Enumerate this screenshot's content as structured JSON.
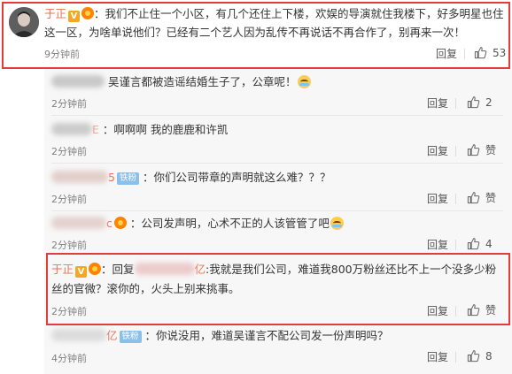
{
  "main_comment": {
    "username": "于正",
    "verified_badge": "V",
    "body": "：我们不止住一个小区，有几个还住上下楼，欢娱的导演就住我楼下，好多明星也住这一区，为啥单说他们？已经有二个艺人因为乱传不再说话不再合作了，别再来一次！",
    "time": "9分钟前",
    "reply_label": "回复",
    "like_count": "53"
  },
  "replies": [
    {
      "name": "",
      "body": "吴谨言都被造谣结婚生子了，公章呢！",
      "time": "2分钟前",
      "reply_label": "回复",
      "like_count": "2",
      "emoji": "crying-laughing"
    },
    {
      "name": "E",
      "body": "：啊啊啊  我的鹿鹿和许凯",
      "time": "2分钟前",
      "reply_label": "回复",
      "like_count": "赞"
    },
    {
      "name": "5",
      "badge": "铁粉",
      "body": "：你们公司带章的声明就这么难？？？",
      "time": "2分钟前",
      "reply_label": "回复",
      "like_count": "赞"
    },
    {
      "name": "c",
      "body": "：公司发声明，心术不正的人该管管了吧",
      "time": "2分钟前",
      "reply_label": "回复",
      "like_count": "4",
      "emoji": "crying-laughing"
    },
    {
      "name": "于正",
      "verified_badge": "V",
      "reply_prefix": "：回复",
      "reply_target": "亿",
      "body_line1": ":我就是我们公司，难道我800万粉丝还比不上一个没多少粉",
      "body_line2": "丝的官微？滚你的，火头上别来挑事。",
      "time": "2分钟前",
      "reply_label": "回复",
      "like_count": "赞"
    },
    {
      "name": "亿",
      "badge": "铁粉",
      "body": "：你说没用，难道吴谨言不配公司发一份声明吗？",
      "time": "4分钟前",
      "reply_label": "回复",
      "like_count": "8"
    }
  ],
  "colors": {
    "username": "#eb7350",
    "highlight_border": "#e63b3b",
    "reply_bg": "#f7f7f7",
    "badge_iron": "#8ac0ea",
    "badge_v": "#f5a623"
  },
  "icons": {
    "like": "thumbs-up-icon",
    "avatar": "avatar",
    "fan": "fan-badge-icon",
    "emoji": "crying-laughing-emoji"
  }
}
